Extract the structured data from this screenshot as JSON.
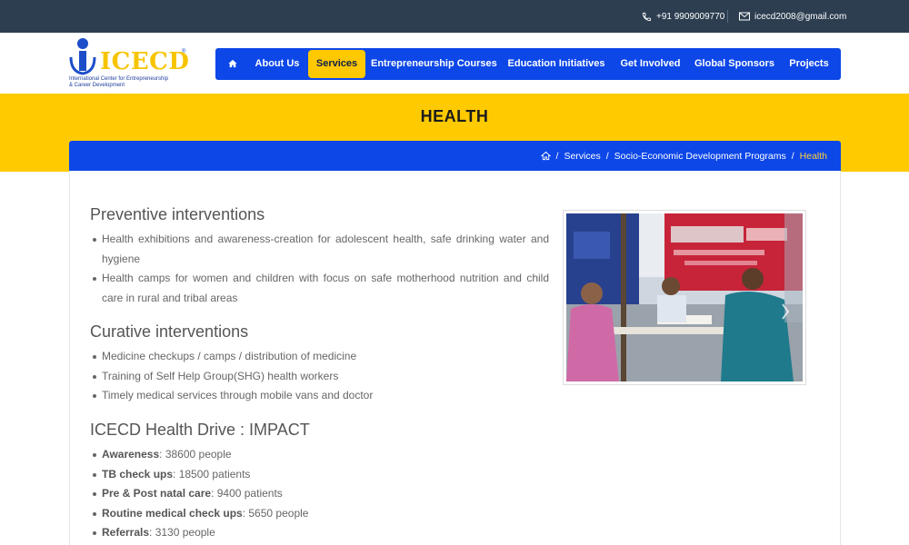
{
  "topbar": {
    "phone": "+91 9909009770",
    "email": "icecd2008@gmail.com"
  },
  "logo": {
    "name": "ICECD",
    "registered": "®",
    "subtitle_line1": "International Center for Entrepreneurship",
    "subtitle_line2": "& Career Development"
  },
  "nav": {
    "home_icon": "home-icon",
    "items": [
      {
        "label": "About Us"
      },
      {
        "label": "Services",
        "active": true
      },
      {
        "label": "Entrepreneurship Courses"
      },
      {
        "label": "Education Initiatives"
      },
      {
        "label": "Get Involved"
      },
      {
        "label": "Global Sponsors"
      },
      {
        "label": "Projects"
      }
    ]
  },
  "page": {
    "title": "HEALTH"
  },
  "breadcrumb": {
    "home_icon": "home-icon",
    "items": [
      "Services",
      "Socio-Economic Development Programs",
      "Health"
    ],
    "separator": "/"
  },
  "sections": {
    "preventive": {
      "title": "Preventive interventions",
      "items": [
        "Health exhibitions and awareness-creation for adolescent health, safe drinking water and hygiene",
        "Health camps for women and children with focus on safe motherhood nutrition and child care in rural and tribal areas"
      ]
    },
    "curative": {
      "title": "Curative interventions",
      "items": [
        "Medicine checkups / camps / distribution of medicine",
        "Training of Self Help Group(SHG) health workers",
        "Timely medical services through mobile vans and doctor"
      ]
    },
    "impact": {
      "title": "ICECD Health Drive : IMPACT",
      "items": [
        {
          "label": "Awareness",
          "value": ": 38600 people"
        },
        {
          "label": "TB check ups",
          "value": ": 18500 patients"
        },
        {
          "label": "Pre & Post natal care",
          "value": ": 9400 patients"
        },
        {
          "label": "Routine medical check ups",
          "value": ": 5650 people"
        },
        {
          "label": "Referrals",
          "value": ": 3130 people"
        }
      ]
    }
  },
  "colors": {
    "topbar": "#2c3e50",
    "primary_blue": "#0d47e8",
    "accent_yellow": "#ffca00",
    "breadcrumb_current": "#ffd23a"
  }
}
